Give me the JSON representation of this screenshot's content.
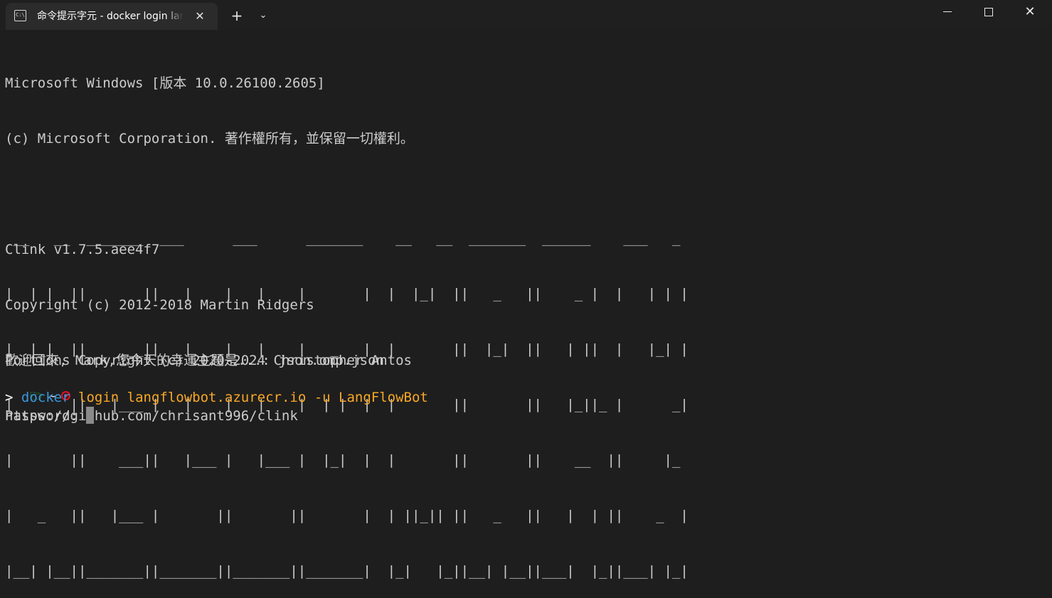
{
  "tab": {
    "title": "命令提示字元 - docker  login langflowbot.azurecr.io -u LangFlowBot",
    "icon": "cmd-icon",
    "icon_text": "C:\\",
    "close_glyph": "✕"
  },
  "titlebar": {
    "new_tab_glyph": "+",
    "dropdown_glyph": "⌄",
    "close_glyph": "✕"
  },
  "terminal": {
    "banner_lines": [
      "Microsoft Windows [版本 10.0.26100.2605]",
      "(c) Microsoft Corporation. 著作權所有，並保留一切權利。",
      "",
      "Clink v1.7.5.aee4f7",
      "Copyright (c) 2012-2018 Martin Ridgers",
      "Portions Copyright (c) 2020-2024 Christopher Antos",
      "https://github.com/chrisant996/clink"
    ],
    "ascii_art": [
      " __   __  _______  ___      ___      _______    __   __  _______  ______    ___   _ ",
      "|  | |  ||       ||   |    |   |    |       |  |  |_|  ||   _   ||    _ |  |   | | |",
      "|  |_|  ||    ___||   |    |   |    |   _   |  |       ||  |_|  ||   | ||  |   |_| |",
      "|       ||   |___ |   |    |   |    |  | |  |  |       ||       ||   |_||_ |      _|",
      "|       ||    ___||   |___ |   |___ |  |_|  |  |       ||       ||    __  ||     |_ ",
      "|   _   ||   |___ |       ||       ||       |  | ||_|| ||   _   ||   |  | ||    _  |",
      "|__| |__||_______||_______||_______||_______|  |_|   |_||__| |__||___|  |_||___| |_|"
    ],
    "welcome": "歡迎回來, Mark,您今天的幸運主題是...: json.omp.json",
    "prompt": {
      "folder_icon": "folder-icon",
      "folder_glyph": "🗁",
      "path": "~",
      "status_icon": "record-icon",
      "status_color": "#e81123"
    },
    "command": {
      "caret": ">",
      "name": "docker",
      "args": "login langflowbot.azurecr.io -u LangFlowBot",
      "name_color": "#3a96dd",
      "args_color": "#f9a825"
    },
    "password_label": "Password: "
  }
}
